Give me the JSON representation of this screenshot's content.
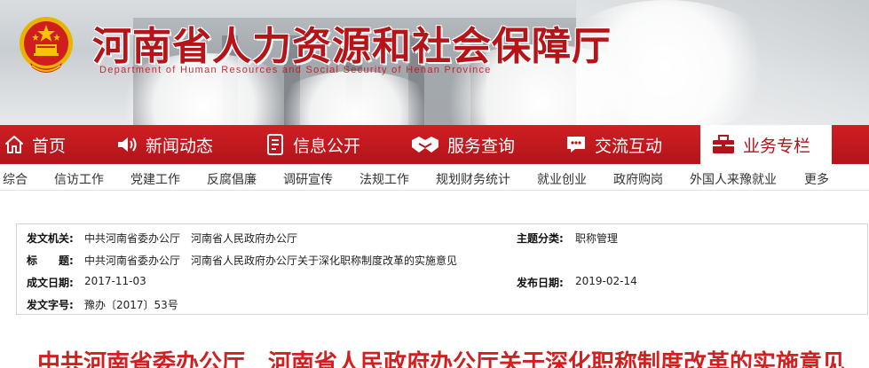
{
  "header": {
    "title": "河南省人力资源和社会保障厅",
    "subtitle": "Department of Human Resources and Social Security of Henan Province",
    "brand_color": "#b7141a",
    "emblem_icon": "national-emblem-icon"
  },
  "main_nav": {
    "items": [
      {
        "label": "首页",
        "icon": "home-icon"
      },
      {
        "label": "新闻动态",
        "icon": "speaker-icon"
      },
      {
        "label": "信息公开",
        "icon": "document-icon"
      },
      {
        "label": "服务查询",
        "icon": "handshake-icon"
      },
      {
        "label": "交流互动",
        "icon": "chat-icon"
      },
      {
        "label": "业务专栏",
        "icon": "briefcase-icon",
        "active": true
      }
    ]
  },
  "sub_nav": {
    "items": [
      "综合",
      "信访工作",
      "党建工作",
      "反腐倡廉",
      "调研宣传",
      "法规工作",
      "规划财务统计",
      "就业创业",
      "政府购岗",
      "外国人来豫就业",
      "更多"
    ]
  },
  "info": {
    "issuer_label": "发文机关:",
    "issuer_value": "中共河南省委办公厅　河南省人民政府办公厅",
    "topic_label": "主题分类:",
    "topic_value": "职称管理",
    "title_label": "标　　题:",
    "title_value": "中共河南省委办公厅　河南省人民政府办公厅关于深化职称制度改革的实施意见",
    "created_label": "成文日期:",
    "created_value": "2017-11-03",
    "published_label": "发布日期:",
    "published_value": "2019-02-14",
    "doc_no_label": "发文字号:",
    "doc_no_value": "豫办〔2017〕53号"
  },
  "article": {
    "title": "中共河南省委办公厅　河南省人民政府办公厅关于深化职称制度改革的实施意见"
  }
}
